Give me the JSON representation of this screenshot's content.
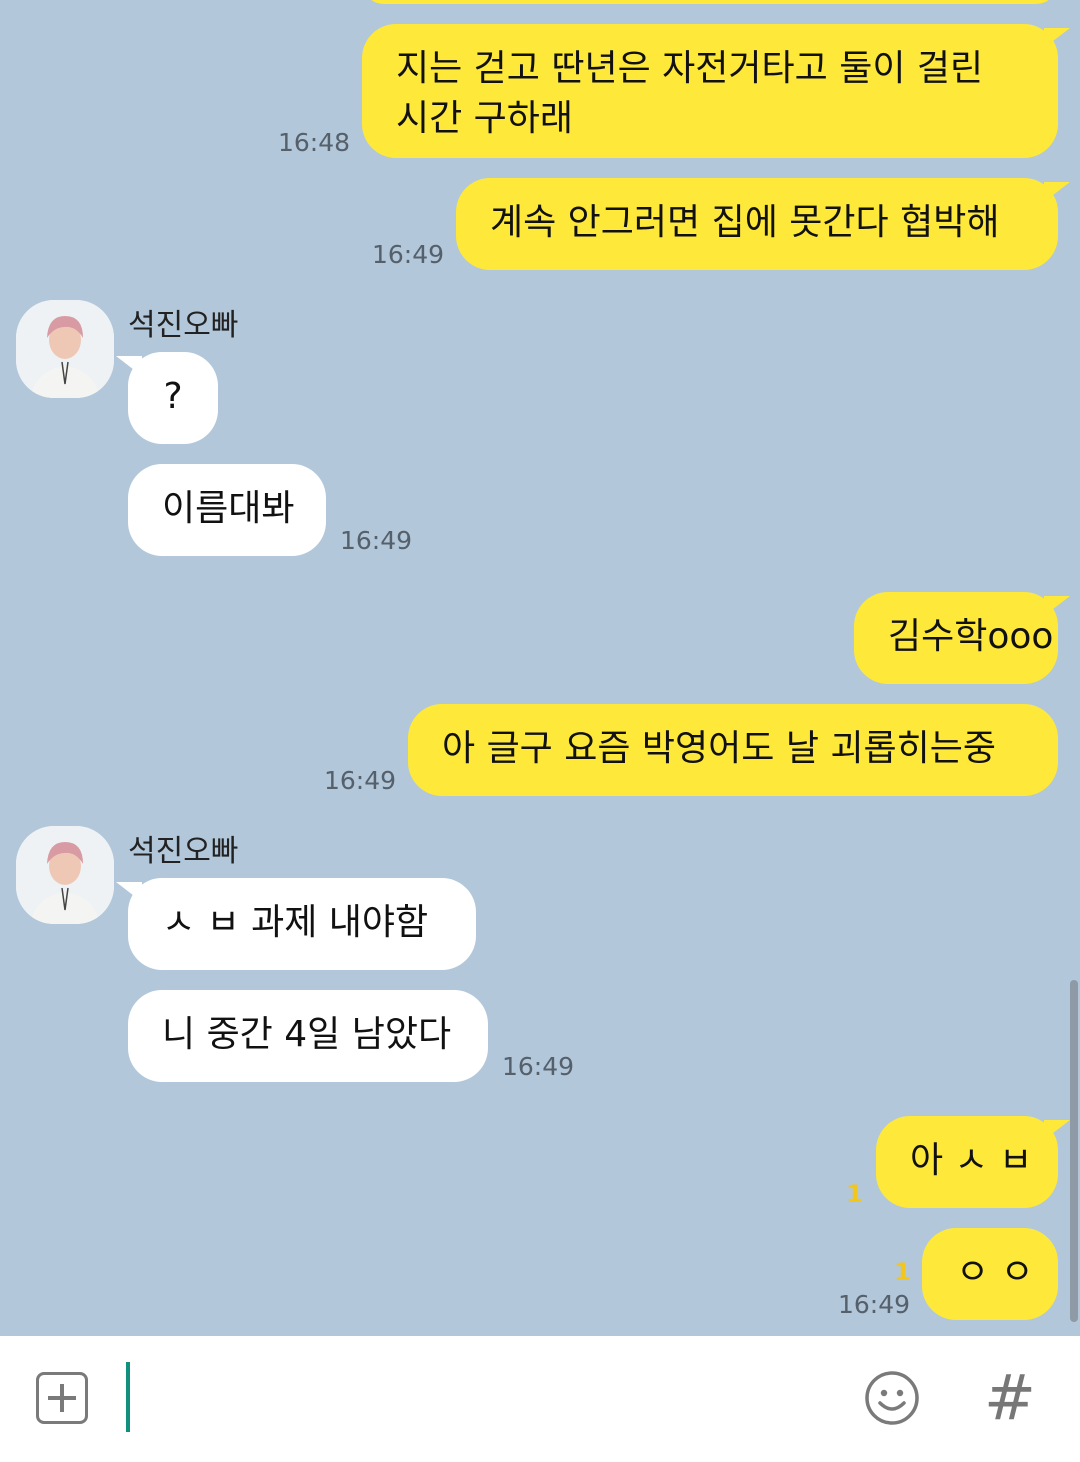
{
  "contact": {
    "name": "석진오빠"
  },
  "messages": {
    "m1": {
      "text": "지는 걷고 딴년은 자전거타고 둘이 걸린",
      "text2": "시간 구하래",
      "time": "16:48"
    },
    "m2": {
      "text": "계속 안그러면 집에 못간다 협박해",
      "time": "16:49"
    },
    "m3": {
      "text": "?"
    },
    "m4": {
      "text": "이름대봐",
      "time": "16:49"
    },
    "m5": {
      "text": "김수학ooo"
    },
    "m6": {
      "text": "아 글구 요즘 박영어도 날 괴롭히는중",
      "time": "16:49"
    },
    "m7": {
      "text": "ㅅ ㅂ 과제 내야함"
    },
    "m8": {
      "text": "니 중간 4일 남았다",
      "time": "16:49"
    },
    "m9": {
      "text": "아 ㅅ ㅂ",
      "unread": "1"
    },
    "m10": {
      "text": "ㅇ ㅇ",
      "unread": "1",
      "time": "16:49"
    }
  },
  "input": {
    "placeholder": ""
  },
  "icons": {
    "attach": "plus-icon",
    "emoji": "emoji-icon",
    "hash": "hash-icon"
  },
  "colors": {
    "background": "#b2c7da",
    "my_bubble": "#fee83a",
    "their_bubble": "#ffffff",
    "cursor": "#11907e"
  }
}
